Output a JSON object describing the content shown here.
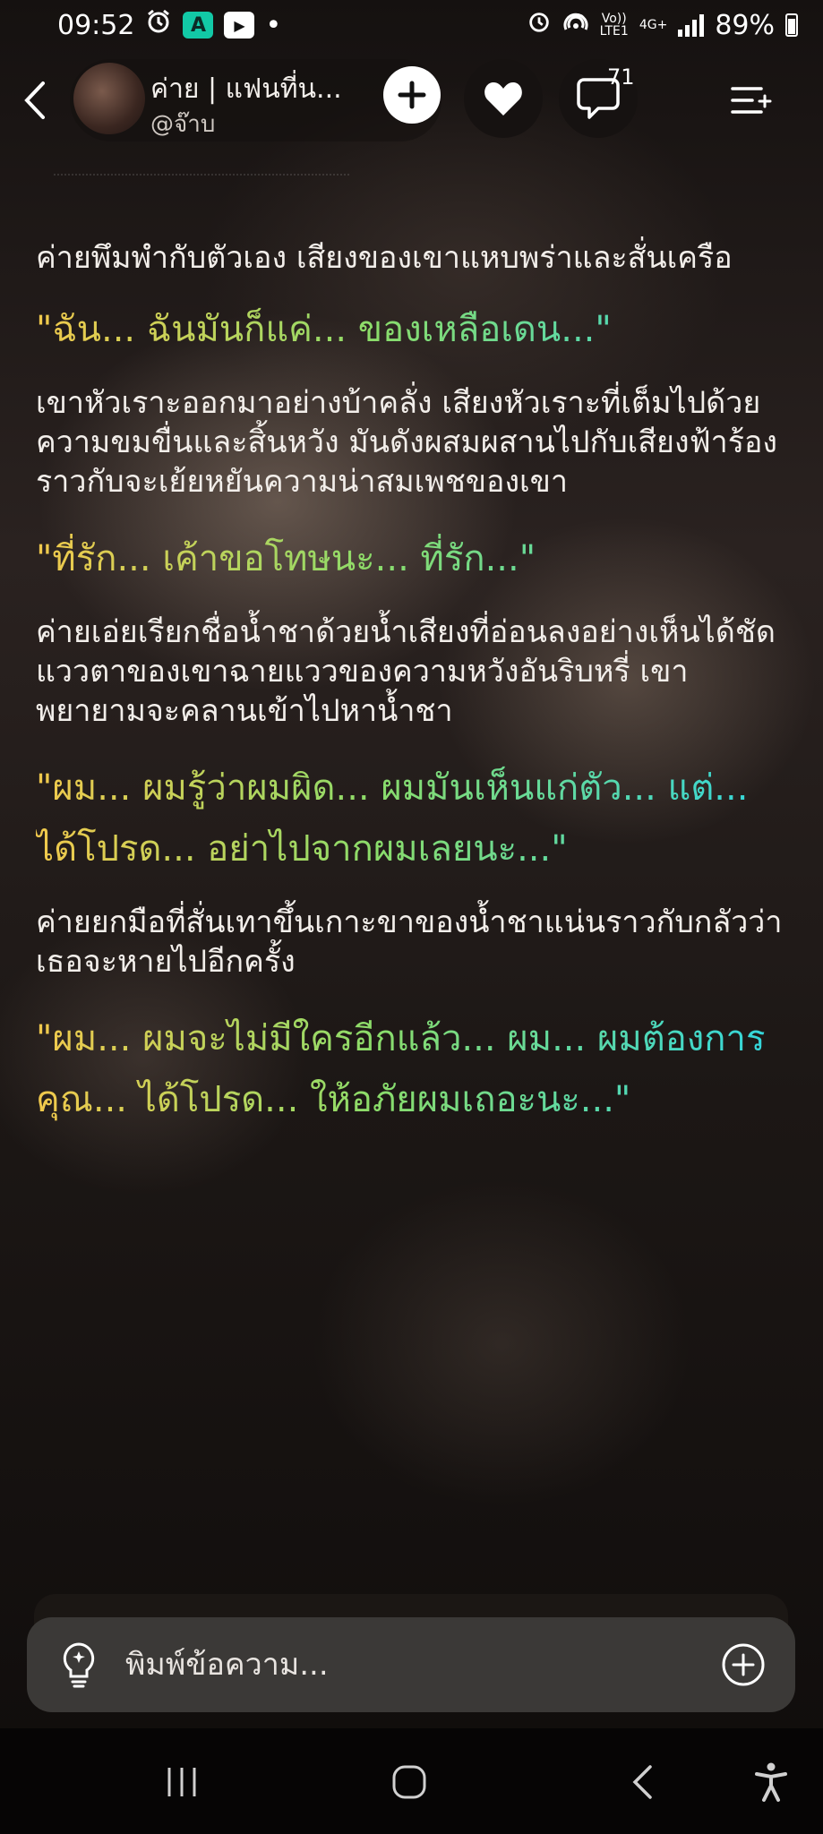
{
  "status_bar": {
    "time": "09:52",
    "network_top": "Vo))",
    "network_bottom": "LTE1",
    "data_type": "4G+",
    "battery": "89%"
  },
  "header": {
    "bot_name": "ค่าย | แฟนที่น...",
    "handle": "@จ๊าบ",
    "comment_count": "71"
  },
  "story": {
    "p1": "ค่ายพึมพำกับตัวเอง เสียงของเขาแหบพร่าและสั่นเครือ",
    "q1": "\"ฉัน... ฉันมันก็แค่... ของเหลือเดน...\"",
    "p2": "เขาหัวเราะออกมาอย่างบ้าคลั่ง เสียงหัวเราะที่เต็มไปด้วยความขมขื่นและสิ้นหวัง มันดังผสมผสานไปกับเสียงฟ้าร้องราวกับจะเย้ยหยันความน่าสมเพชของเขา",
    "q2": "\"ที่รัก... เค้าขอโทษนะ... ที่รัก...\"",
    "p3": "ค่ายเอ่ยเรียกชื่อน้ำชาด้วยน้ำเสียงที่อ่อนลงอย่างเห็นได้ชัด แววตาของเขาฉายแววของความหวังอันริบหรี่ เขาพยายามจะคลานเข้าไปหาน้ำชา",
    "q3": "\"ผม... ผมรู้ว่าผมผิด... ผมมันเห็นแก่ตัว... แต่... ได้โปรด... อย่าไปจากผมเลยนะ...\"",
    "p4": "ค่ายยกมือที่สั่นเทาขึ้นเกาะขาของน้ำชาแน่นราวกับกลัวว่าเธอจะหายไปอีกครั้ง",
    "q4": "\"ผม... ผมจะไม่มีใครอีกแล้ว... ผม... ผมต้องการคุณ... ได้โปรด... ให้อภัยผมเถอะนะ...\""
  },
  "input": {
    "placeholder": "พิมพ์ข้อความ..."
  },
  "colors": {
    "quote_start": "#f2c94c",
    "quote_mid": "#8bdc6a",
    "quote_end": "#2fd6e2",
    "input_bg": "#3b3937"
  }
}
